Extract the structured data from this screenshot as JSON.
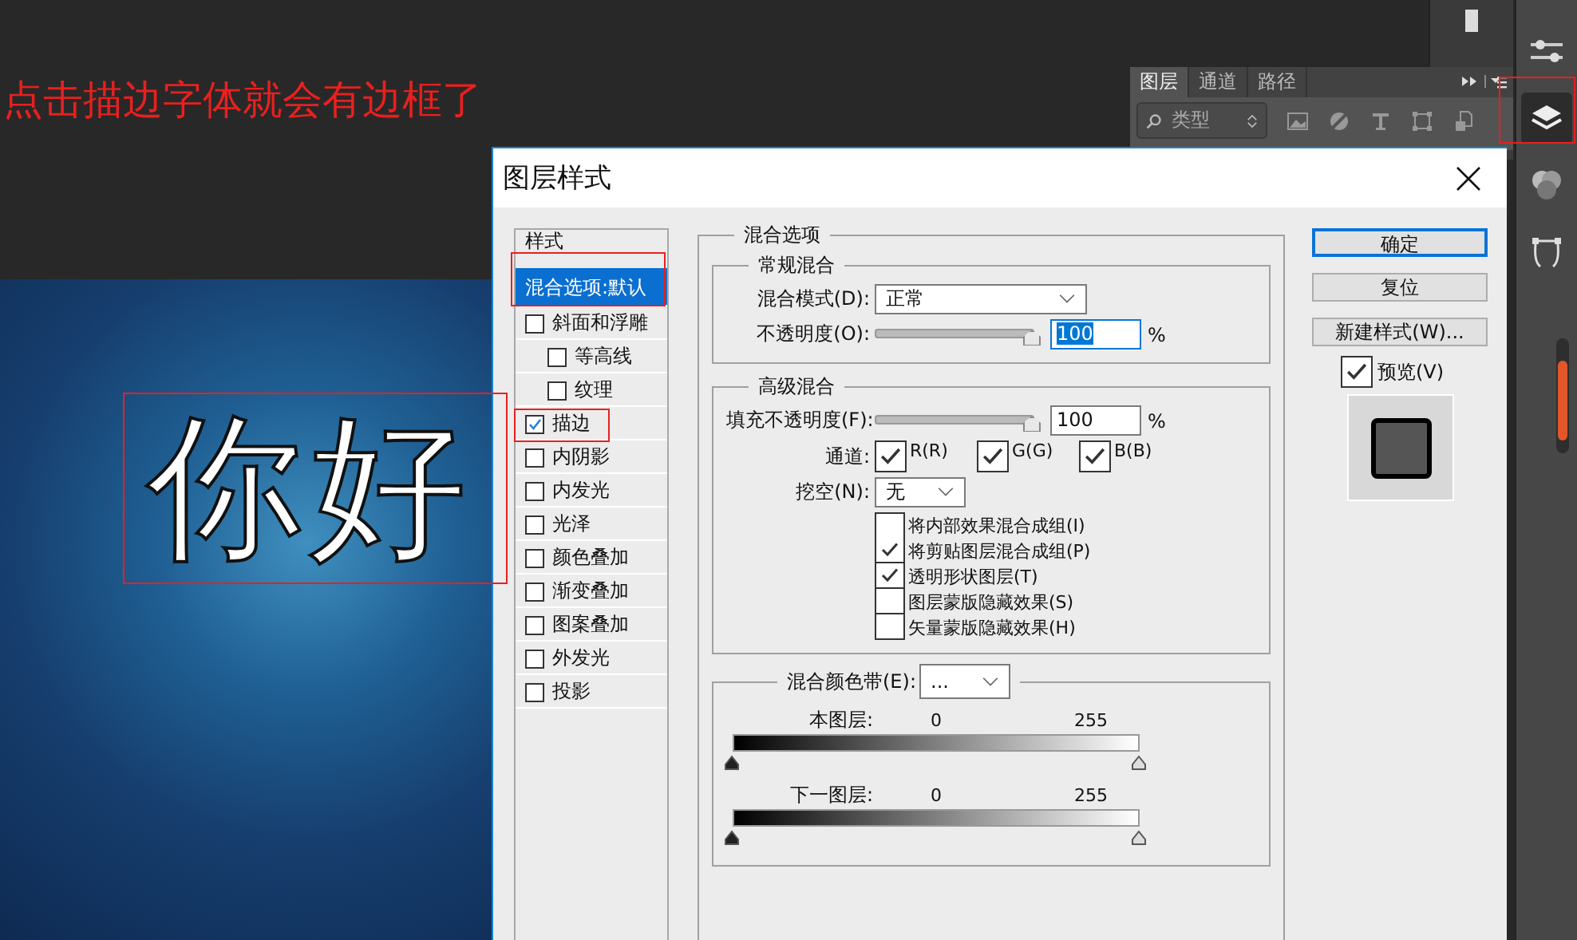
{
  "annotation": {
    "text": "点击描边字体就会有边框了"
  },
  "canvas": {
    "text": "你好"
  },
  "layers_panel": {
    "tabs": [
      {
        "label": "图层",
        "selected": true
      },
      {
        "label": "通道",
        "selected": false
      },
      {
        "label": "路径",
        "selected": false
      }
    ],
    "filter": "类型"
  },
  "dialog": {
    "title": "图层样式",
    "styles": {
      "header": "样式",
      "items": [
        {
          "label": "混合选项:默认",
          "kind": "heading",
          "selected": true
        },
        {
          "label": "斜面和浮雕",
          "kind": "check",
          "checked": false,
          "selected": false,
          "children": [
            {
              "label": "等高线",
              "kind": "check",
              "checked": false,
              "selected": false
            },
            {
              "label": "纹理",
              "kind": "check",
              "checked": false,
              "selected": false
            }
          ]
        },
        {
          "label": "描边",
          "kind": "check",
          "checked": true,
          "selected": false
        },
        {
          "label": "内阴影",
          "kind": "check",
          "checked": false,
          "selected": false
        },
        {
          "label": "内发光",
          "kind": "check",
          "checked": false,
          "selected": false
        },
        {
          "label": "光泽",
          "kind": "check",
          "checked": false,
          "selected": false
        },
        {
          "label": "颜色叠加",
          "kind": "check",
          "checked": false,
          "selected": false
        },
        {
          "label": "渐变叠加",
          "kind": "check",
          "checked": false,
          "selected": false
        },
        {
          "label": "图案叠加",
          "kind": "check",
          "checked": false,
          "selected": false
        },
        {
          "label": "外发光",
          "kind": "check",
          "checked": false,
          "selected": false
        },
        {
          "label": "投影",
          "kind": "check",
          "checked": false,
          "selected": false
        }
      ]
    },
    "blending": {
      "title": "混合选项",
      "general": {
        "title": "常规混合",
        "mode_label": "混合模式(D):",
        "mode": "正常",
        "opacity_label": "不透明度(O):",
        "opacity": {
          "level": 1
        },
        "opacity_value": "100",
        "unit": "%"
      },
      "advanced": {
        "title": "高级混合",
        "fill_label": "填充不透明度(F):",
        "fill": {
          "level": 1
        },
        "fill_value": "100",
        "unit": "%",
        "channels_label": "通道:",
        "channels": [
          {
            "label": "R(R)",
            "checked": true
          },
          {
            "label": "G(G)",
            "checked": true
          },
          {
            "label": "B(B)",
            "checked": true
          }
        ],
        "knockout_label": "挖空(N):",
        "knockout": "无",
        "options": [
          {
            "label": "将内部效果混合成组(I)",
            "checked": false
          },
          {
            "label": "将剪贴图层混合成组(P)",
            "checked": true
          },
          {
            "label": "透明形状图层(T)",
            "checked": true
          },
          {
            "label": "图层蒙版隐藏效果(S)",
            "checked": false
          },
          {
            "label": "矢量蒙版隐藏效果(H)",
            "checked": false
          }
        ]
      },
      "blend_if": {
        "label": "混合颜色带(E):",
        "value": "...",
        "bands": [
          {
            "label": "本图层:",
            "low": "0",
            "high": "255",
            "thumbs": [
              {
                "level": 0
              },
              {
                "level": 1
              }
            ]
          },
          {
            "label": "下一图层:",
            "low": "0",
            "high": "255",
            "thumbs": [
              {
                "level": 0
              },
              {
                "level": 1
              }
            ]
          }
        ]
      }
    },
    "buttons": [
      {
        "label": "确定",
        "default": true
      },
      {
        "label": "复位",
        "default": false
      },
      {
        "label": "新建样式(W)...",
        "default": false
      }
    ],
    "preview": {
      "label": "预览(V)",
      "checked": true
    }
  }
}
